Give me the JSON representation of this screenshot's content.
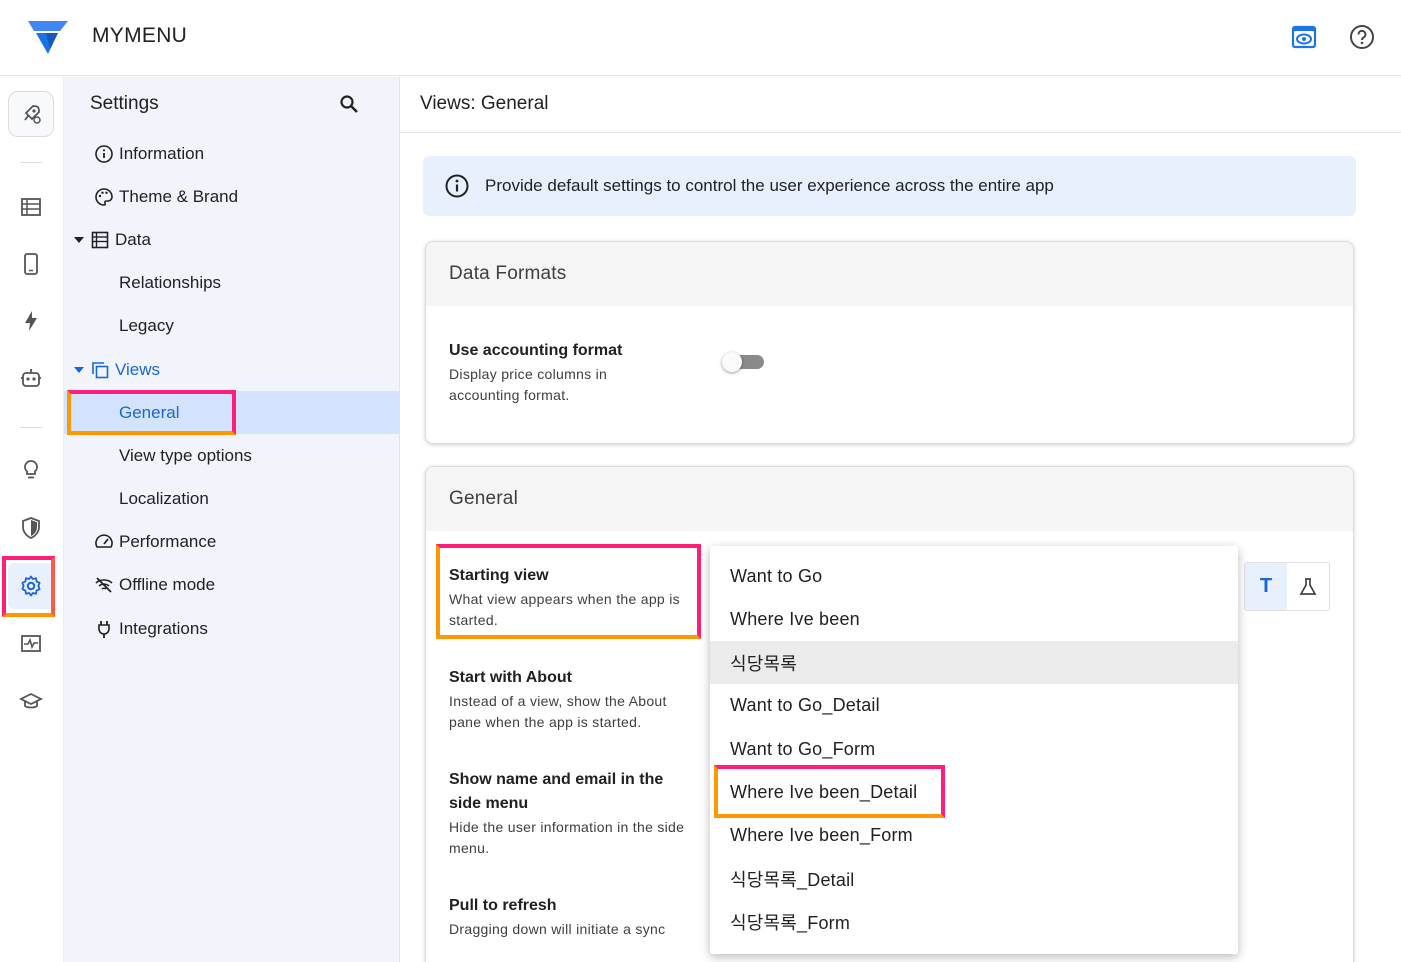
{
  "app": {
    "title": "MYMENU"
  },
  "colors": {
    "accent": "#1a66d2",
    "highlight_pink": "#ff1f7a",
    "highlight_orange": "#ff9800",
    "selected_bg": "#d3e3fd",
    "banner_bg": "#e8f0fe"
  },
  "header": {
    "icons": [
      "preview-eye-icon",
      "help-icon"
    ]
  },
  "rail": {
    "icons": [
      "rocket-icon",
      "data-table-icon",
      "phone-icon",
      "bolt-icon",
      "robot-icon",
      "lightbulb-icon",
      "shield-icon",
      "gear-icon",
      "monitor-icon",
      "school-icon"
    ],
    "active": "gear-icon"
  },
  "settings": {
    "title": "Settings",
    "items": [
      {
        "label": "Information",
        "icon": "info-icon"
      },
      {
        "label": "Theme & Brand",
        "icon": "palette-icon"
      },
      {
        "label": "Data",
        "icon": "table-icon",
        "expanded": true
      },
      {
        "label": "Relationships"
      },
      {
        "label": "Legacy"
      },
      {
        "label": "Views",
        "icon": "views-icon",
        "expanded": true
      },
      {
        "label": "General",
        "selected": true
      },
      {
        "label": "View type options"
      },
      {
        "label": "Localization"
      },
      {
        "label": "Performance",
        "icon": "speedometer-icon"
      },
      {
        "label": "Offline mode",
        "icon": "wifi-off-icon"
      },
      {
        "label": "Integrations",
        "icon": "plug-icon"
      }
    ]
  },
  "main": {
    "title": "Views: General",
    "banner": "Provide default settings to control the user experience across the entire app",
    "data_formats": {
      "title": "Data Formats",
      "accounting": {
        "title": "Use accounting format",
        "desc": "Display price columns in accounting format.",
        "enabled": false
      }
    },
    "general": {
      "title": "General",
      "starting_view": {
        "title": "Starting view",
        "desc": "What view appears when the app is started."
      },
      "start_with_about": {
        "title": "Start with About",
        "desc": "Instead of a view, show the About pane when the app is started."
      },
      "show_name_email": {
        "title": "Show name and email in the side menu",
        "desc": "Hide the user information in the side menu."
      },
      "pull_refresh": {
        "title": "Pull to refresh",
        "desc": "Dragging down will initiate a sync"
      },
      "type_buttons": {
        "text": "T",
        "formula_icon": "flask-icon"
      }
    },
    "dropdown": {
      "options": [
        "Want to Go",
        "Where Ive been",
        "식당목록",
        "Want to Go_Detail",
        "Want to Go_Form",
        "Where Ive been_Detail",
        "Where Ive been_Form",
        "식당목록_Detail",
        "식당목록_Form"
      ],
      "hovered": "식당목록",
      "highlighted": "Where Ive been_Detail"
    }
  }
}
